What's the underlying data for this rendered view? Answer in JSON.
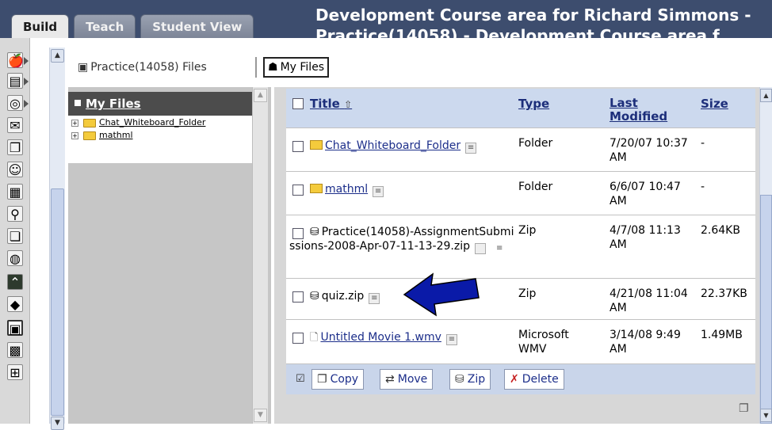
{
  "tabs": [
    {
      "label": "Build",
      "active": true
    },
    {
      "label": "Teach",
      "active": false
    },
    {
      "label": "Student View",
      "active": false
    }
  ],
  "course_title_line1": "Development Course area for Richard Simmons -",
  "course_title_line2": "Practice(14058) - Development Course area f",
  "breadcrumb": {
    "parent": "Practice(14058) Files",
    "current": "My Files"
  },
  "tree": {
    "title": "My Files",
    "items": [
      {
        "label": "Chat_Whiteboard_Folder"
      },
      {
        "label": "mathml"
      }
    ]
  },
  "table": {
    "headers": {
      "title": "Title",
      "type": "Type",
      "last_modified": "Last Modified",
      "size": "Size"
    },
    "rows": [
      {
        "name": "Chat_Whiteboard_Folder",
        "type": "Folder",
        "modified": "7/20/07 10:37 AM",
        "size": "-"
      },
      {
        "name": "mathml",
        "type": "Folder",
        "modified": "6/6/07 10:47 AM",
        "size": "-"
      },
      {
        "name": "Practice(14058)-AssignmentSubmissions-2008-Apr-07-11-13-29.zip",
        "type": "Zip",
        "modified": "4/7/08 11:13 AM",
        "size": "2.64KB"
      },
      {
        "name": "quiz.zip",
        "type": "Zip",
        "modified": "4/21/08 11:04 AM",
        "size": "22.37KB"
      },
      {
        "name": "Untitled Movie 1.wmv",
        "type": "Microsoft WMV",
        "modified": "3/14/08 9:49 AM",
        "size": "1.49MB"
      }
    ]
  },
  "actions": {
    "copy": "Copy",
    "move": "Move",
    "zip": "Zip",
    "delete": "Delete"
  },
  "colors": {
    "topbar": "#3d4d6e",
    "header_row": "#ccd9ee",
    "link": "#1c2e8a",
    "annotation_arrow": "#0a1aa8"
  }
}
